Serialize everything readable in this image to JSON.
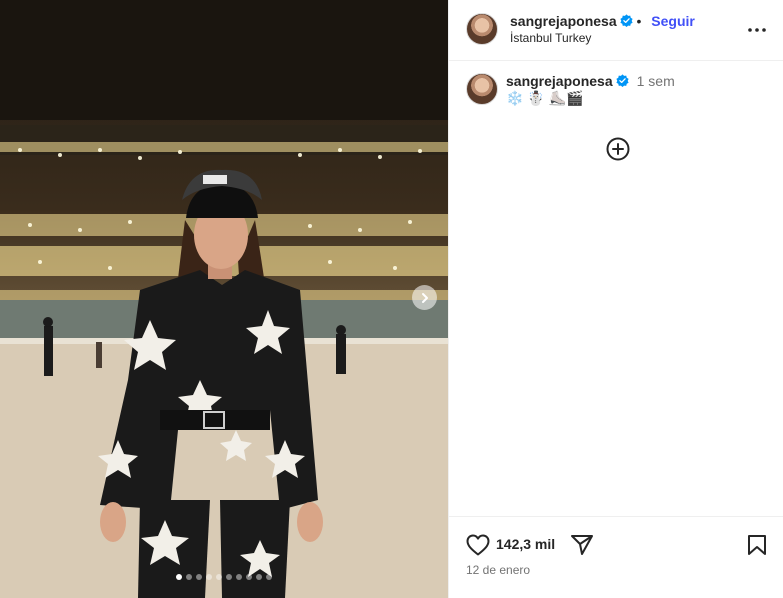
{
  "post": {
    "username": "sangrejaponesa",
    "follow_label": "Seguir",
    "location": "İstanbul Turkey",
    "caption_time": "1 sem",
    "caption_text": "❄️ ☃️ ⛸️🎬",
    "likes": "142,3 mil",
    "date": "12 de enero",
    "carousel": {
      "total": 10,
      "active_index": 0
    }
  },
  "icons": {
    "verified": "verified-badge-icon",
    "more": "more-options-icon",
    "load_more": "plus-circle-icon",
    "like": "heart-icon",
    "share": "paper-plane-icon",
    "save": "bookmark-icon",
    "next": "chevron-right-icon"
  },
  "colors": {
    "link_blue": "#4150f7",
    "verified_blue": "#0095f6",
    "muted_text": "#737373"
  }
}
